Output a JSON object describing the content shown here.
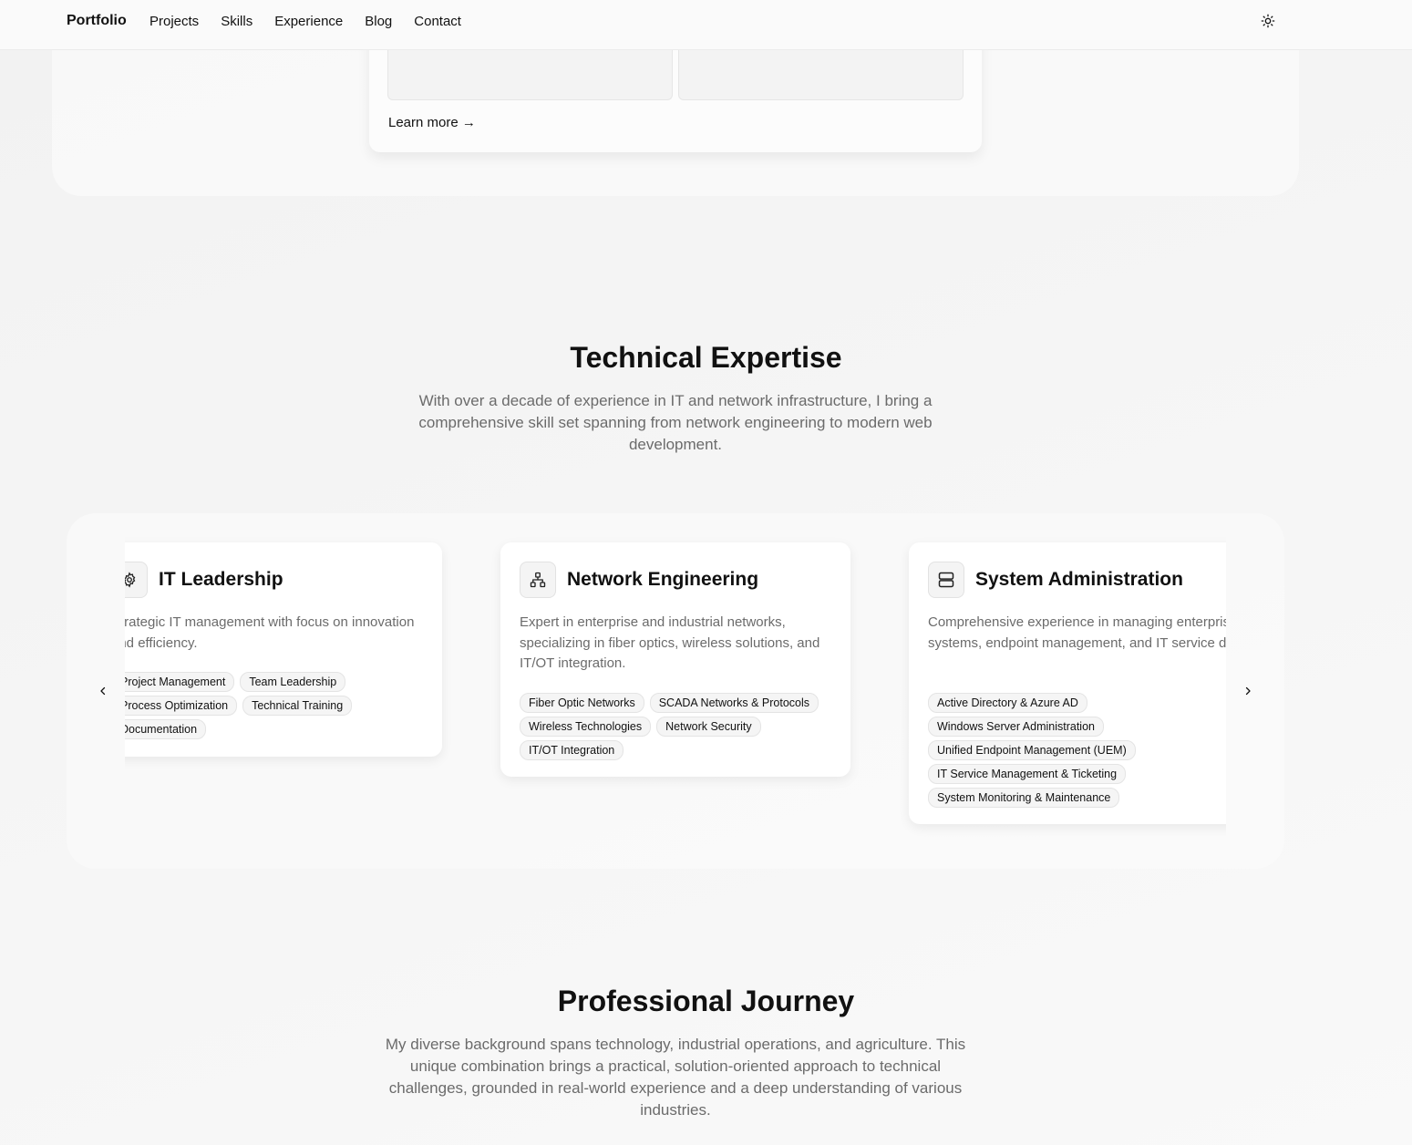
{
  "nav": {
    "brand": "Portfolio",
    "links": [
      "Projects",
      "Skills",
      "Experience",
      "Blog",
      "Contact"
    ],
    "theme_icon": "sun-icon"
  },
  "prev_section": {
    "learn_more": "Learn more →"
  },
  "expertise": {
    "title": "Technical Expertise",
    "lead": "With over a decade of experience in IT and network infrastructure, I bring a comprehensive skill set spanning from network engineering to modern web development.",
    "cards": [
      {
        "icon": "gear-icon",
        "title": "IT Leadership",
        "desc": "Strategic IT management with focus on innovation and efficiency.",
        "tags": [
          "Project Management",
          "Team Leadership",
          "Process Optimization",
          "Technical Training",
          "Documentation"
        ]
      },
      {
        "icon": "network-icon",
        "title": "Network Engineering",
        "desc": "Expert in enterprise and industrial networks, specializing in fiber optics, wireless solutions, and IT/OT integration.",
        "tags": [
          "Fiber Optic Networks",
          "SCADA Networks & Protocols",
          "Wireless Technologies",
          "Network Security",
          "IT/OT Integration"
        ]
      },
      {
        "icon": "server-icon",
        "title": "System Administration",
        "desc": "Comprehensive experience in managing enterprise systems, endpoint management, and IT service delivery.",
        "tags": [
          "Active Directory & Azure AD",
          "Windows Server Administration",
          "Unified Endpoint Management (UEM)",
          "IT Service Management & Ticketing",
          "System Monitoring & Maintenance"
        ]
      }
    ],
    "prev_icon": "chevron-left-icon",
    "next_icon": "chevron-right-icon"
  },
  "journey": {
    "title": "Professional Journey",
    "lead": "My diverse background spans technology, industrial operations, and agriculture. This unique combination brings a practical, solution-oriented approach to technical challenges, grounded in real-world experience and a deep understanding of various industries."
  }
}
